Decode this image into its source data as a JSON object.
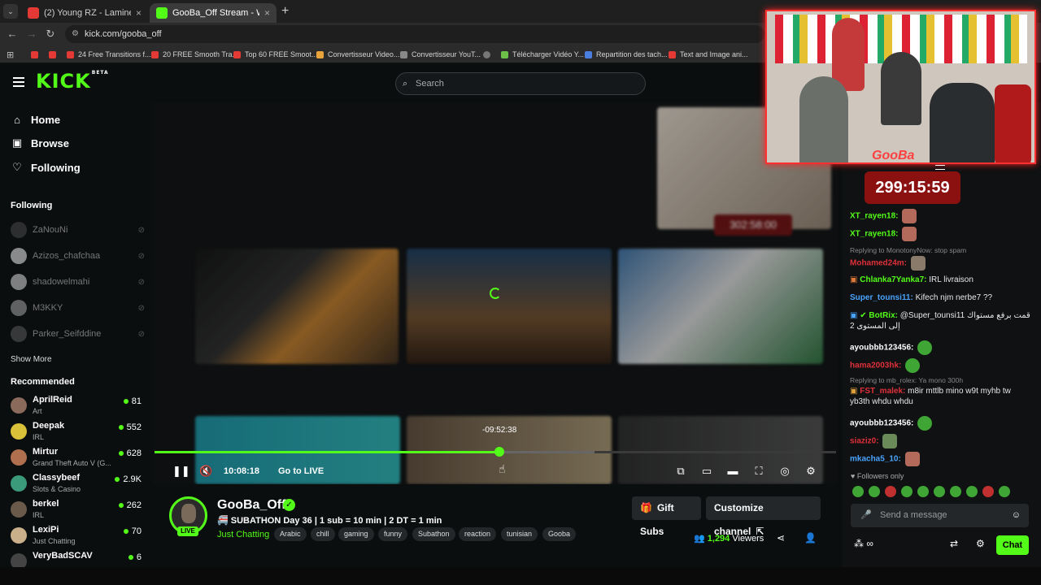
{
  "browser": {
    "tabs": [
      {
        "title": "(2) Young RZ - Lamine Yamal (C",
        "active": false
      },
      {
        "title": "GooBa_Off Stream - Watch Live",
        "active": true
      }
    ],
    "url": "kick.com/gooba_off",
    "bookmarks": [
      "24 Free Transitions f...",
      "20 FREE Smooth Tra...",
      "Top 60 FREE Smoot...",
      "Convertisseur Video...",
      "Convertisseur YouT...",
      "Télécharger Vidéo Y...",
      "Repartition des tach...",
      "Text and Image ani..."
    ]
  },
  "header": {
    "logo": "KICK",
    "logo_sup": "BETA",
    "search_placeholder": "Search"
  },
  "sidebar": {
    "nav": [
      {
        "label": "Home",
        "icon": "home-icon"
      },
      {
        "label": "Browse",
        "icon": "browse-icon"
      },
      {
        "label": "Following",
        "icon": "heart-icon"
      }
    ],
    "following_heading": "Following",
    "following": [
      "ZaNouNi",
      "Azizos_chafchaa",
      "shadowelmahi",
      "M3KKY",
      "Parker_Seifddine"
    ],
    "show_more": "Show More",
    "recommended_heading": "Recommended",
    "recommended": [
      {
        "name": "AprilReid",
        "category": "Art",
        "viewers": "81"
      },
      {
        "name": "Deepak",
        "category": "IRL",
        "viewers": "552"
      },
      {
        "name": "Mirtur",
        "category": "Grand Theft Auto V (G...",
        "viewers": "628"
      },
      {
        "name": "Classybeef",
        "category": "Slots & Casino",
        "viewers": "2.9K"
      },
      {
        "name": "berkel",
        "category": "IRL",
        "viewers": "262"
      },
      {
        "name": "LexiPi",
        "category": "Just Chatting",
        "viewers": "70"
      },
      {
        "name": "VeryBadSCAV",
        "category": "",
        "viewers": "6"
      }
    ]
  },
  "player": {
    "hover_time": "-09:52:38",
    "current_time": "10:08:18",
    "go_live": "Go to LIVE",
    "progress": 0.506,
    "buffered": 0.645,
    "inner_timer": "302:58:00"
  },
  "channel": {
    "name": "GooBa_Off",
    "live": "LIVE",
    "title": "🚝 SUBATHON Day 36 | 1 sub = 10 min | 2 DT = 1 min",
    "category": "Just Chatting",
    "tags": [
      "Arabic",
      "chill",
      "gaming",
      "funny",
      "Subathon",
      "reaction",
      "tunisian",
      "Gooba"
    ],
    "gift_subs": "Gift Subs",
    "customize": "Customize channel",
    "viewers_count": "1,294",
    "viewers_label": "Viewers"
  },
  "overlay": {
    "label": "GooBa",
    "timer": "299:15:59"
  },
  "chat": {
    "messages": [
      {
        "user": "XT_rayen18:",
        "text": "",
        "color": "#53fc18"
      },
      {
        "user": "XT_rayen18:",
        "text": "",
        "color": "#53fc18"
      },
      {
        "reply": "Replying to MonotonyNow: stop spam"
      },
      {
        "user": "Mohamed24m:",
        "text": "",
        "color": "#e0303a"
      },
      {
        "user": "Chlanka7Yanka7:",
        "text": "IRL livraison",
        "color": "#53fc18"
      },
      {
        "user": "Super_tounsi11:",
        "text": "Kifech njm nerbe7 ??",
        "color": "#4aa3ff"
      },
      {
        "user": "BotRix:",
        "text": "@Super_tounsi11 قمت برفع مستواك إلى المستوى 2",
        "color": "#53fc18"
      },
      {
        "user": "ayoubbb123456:",
        "text": "",
        "color": "#ffffff"
      },
      {
        "user": "hama2003hk:",
        "text": "",
        "color": "#e0303a"
      },
      {
        "reply": "Replying to mb_rolex: Ya mono 300h"
      },
      {
        "user": "FST_malek:",
        "text": "m8ir mttlb mino w9t myhb tw yb3th whdu whdu",
        "color": "#e0303a"
      },
      {
        "user": "ayoubbb123456:",
        "text": "",
        "color": "#ffffff"
      },
      {
        "user": "siaziz0:",
        "text": "",
        "color": "#e0303a"
      },
      {
        "user": "mkacha5_10:",
        "text": "",
        "color": "#4aa3ff"
      }
    ],
    "followers_only": "Followers only",
    "send_placeholder": "Send a message",
    "chat_button": "Chat"
  },
  "colors": {
    "accent": "#53fc18",
    "background": "#0b0e0f",
    "overlay_border": "#ff3030"
  }
}
